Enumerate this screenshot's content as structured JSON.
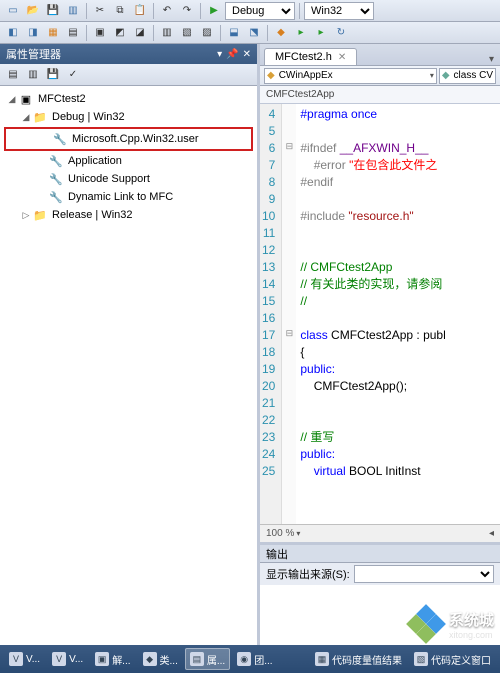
{
  "toolbars": {
    "config_combo": "Debug",
    "platform_combo": "Win32"
  },
  "property_manager": {
    "title": "属性管理器",
    "tree": {
      "root": "MFCtest2",
      "debug_folder": "Debug | Win32",
      "items": [
        "Microsoft.Cpp.Win32.user",
        "Application",
        "Unicode Support",
        "Dynamic Link to MFC"
      ],
      "release_folder": "Release | Win32"
    }
  },
  "editor": {
    "tab": "MFCtest2.h",
    "scope_combo": "CWinAppEx",
    "member_combo": "class CV",
    "breadcrumb": "CMFCtest2App",
    "lines": {
      "l4": "#pragma once",
      "l6": "#ifndef",
      "l6m": "__AFXWIN_H__",
      "l7a": "#error",
      "l7b": "\"在包含此文件之",
      "l8": "#endif",
      "l10a": "#include",
      "l10b": "\"resource.h\"",
      "l13": "// CMFCtest2App",
      "l14": "// 有关此类的实现，请参阅",
      "l15": "//",
      "l17a": "class",
      "l17b": " CMFCtest2App : publ",
      "l18": "{",
      "l19": "public:",
      "l20": "    CMFCtest2App();",
      "l23": "// 重写",
      "l24": "public:",
      "l25a": "    virtual",
      "l25b": " BOOL InitInst"
    },
    "zoom": "100 %"
  },
  "output": {
    "title": "输出",
    "source_label": "显示输出来源(S):"
  },
  "taskbar": {
    "items": [
      "V...",
      "V...",
      "解...",
      "类...",
      "属...",
      "团..."
    ],
    "right": [
      "代码度量值结果",
      "代码定义窗口"
    ]
  },
  "watermark": {
    "text": "系统城",
    "sub": "xitong.com"
  }
}
